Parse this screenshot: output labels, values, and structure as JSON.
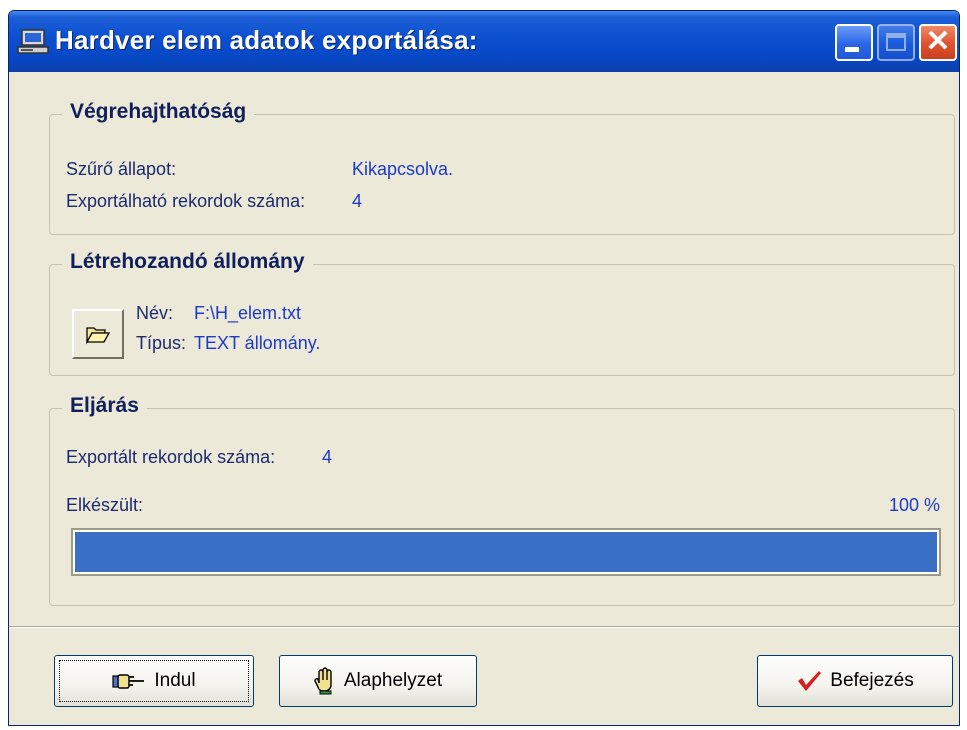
{
  "window": {
    "title": "Hardver elem adatok exportálása:",
    "icons": {
      "app": "computer-icon",
      "minimize": "minimize-icon",
      "maximize": "maximize-icon",
      "close": "close-icon"
    },
    "close_glyph": "✕"
  },
  "executability": {
    "title": "Végrehajthatóság",
    "filter_label": "Szűrő állapot:",
    "filter_value": "Kikapcsolva.",
    "records_label": "Exportálható rekordok száma:",
    "records_value": "4"
  },
  "output_file": {
    "title": "Létrehozandó állomány",
    "browse_icon": "folder-open-icon",
    "name_label": "Név:",
    "name_value": "F:\\H_elem.txt",
    "type_label": "Típus:",
    "type_value": "TEXT állomány."
  },
  "procedure": {
    "title": "Eljárás",
    "exported_label": "Exportált rekordok száma:",
    "exported_value": "4",
    "done_label": "Elkészült:",
    "done_percent_text": "100 %",
    "progress_fraction": 1.0,
    "progress_color": "#3a6fc6"
  },
  "buttons": {
    "start": {
      "label": "Indul",
      "icon": "pointing-hand-icon"
    },
    "reset": {
      "label": "Alaphelyzet",
      "icon": "raised-hand-icon"
    },
    "finish": {
      "label": "Befejezés",
      "icon": "checkmark-icon",
      "icon_color": "#d42020"
    }
  }
}
